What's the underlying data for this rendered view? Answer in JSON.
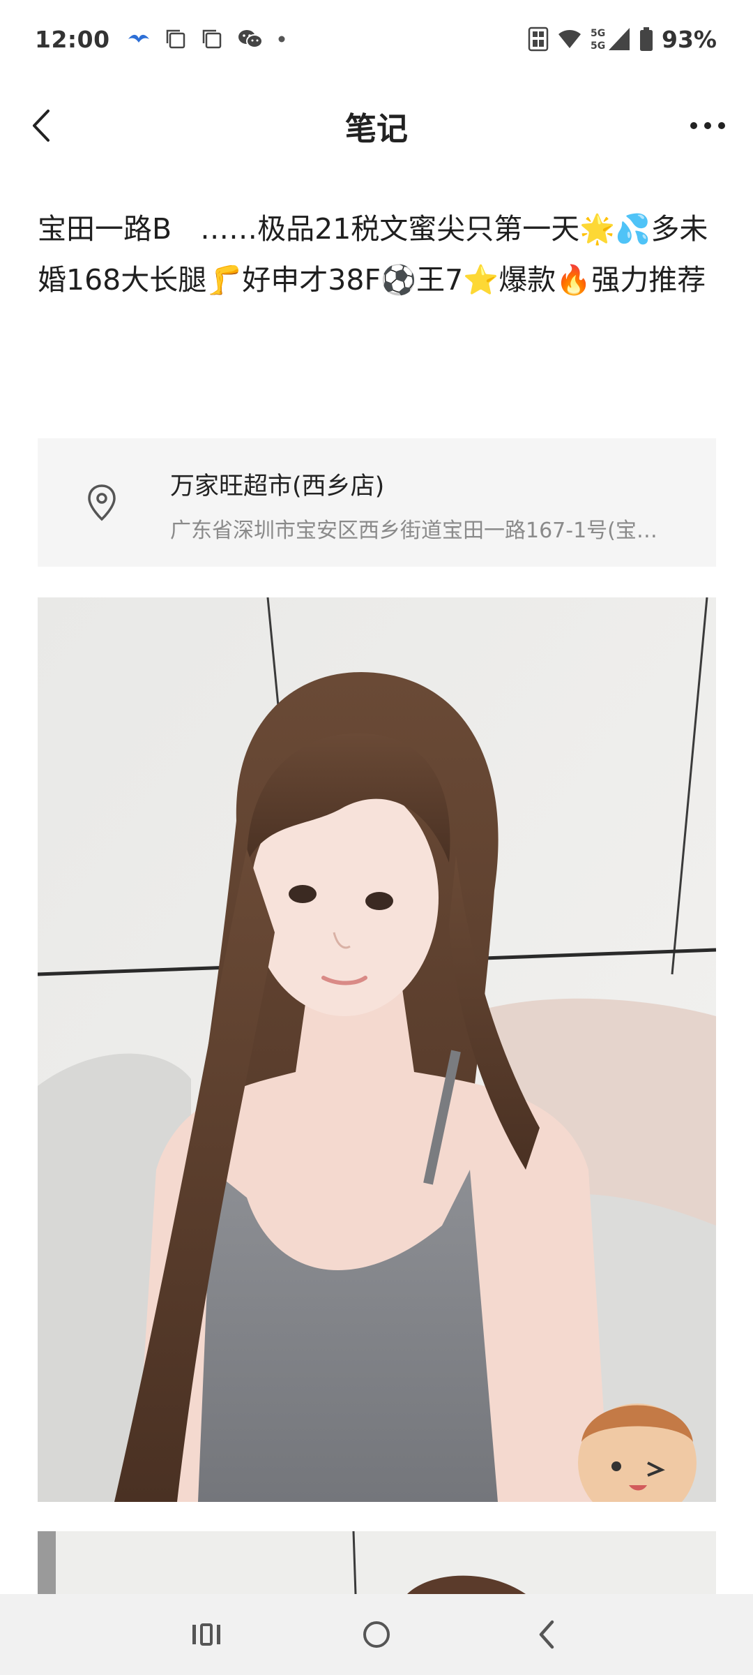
{
  "status_bar": {
    "time": "12:00",
    "battery": "93%",
    "signal_label": "5G",
    "left_icons": [
      "bird-app-icon",
      "copy-icon",
      "copy-icon",
      "wechat-icon",
      "dot-icon"
    ],
    "right_icons": [
      "nfc-icon",
      "wifi-icon",
      "signal-5g-icon",
      "battery-icon"
    ]
  },
  "header": {
    "title": "笔记",
    "back_icon": "chevron-left-icon",
    "more_icon": "more-horizontal-icon"
  },
  "post": {
    "text": "宝田一路B　……极品21税文蜜尖只第一天🌟💦多未婚168大长腿🦵好申才38F⚽王7⭐爆款🔥强力推荐"
  },
  "location": {
    "icon": "map-pin-icon",
    "name": "万家旺超市(西乡店)",
    "address": "广东省深圳市宝安区西乡街道宝田一路167-1号(宝…"
  },
  "photos": [
    {
      "kind": "photo",
      "subject": "portrait"
    },
    {
      "kind": "photo",
      "subject": "portrait-partial"
    }
  ],
  "nav_bar": {
    "recents_icon": "recents-icon",
    "home_icon": "home-icon",
    "back_icon": "back-icon"
  },
  "colors": {
    "background": "#ffffff",
    "text_primary": "#222222",
    "text_secondary": "#8a8a8a",
    "card_background": "#f5f5f5",
    "nav_background": "#f1f1f1"
  }
}
